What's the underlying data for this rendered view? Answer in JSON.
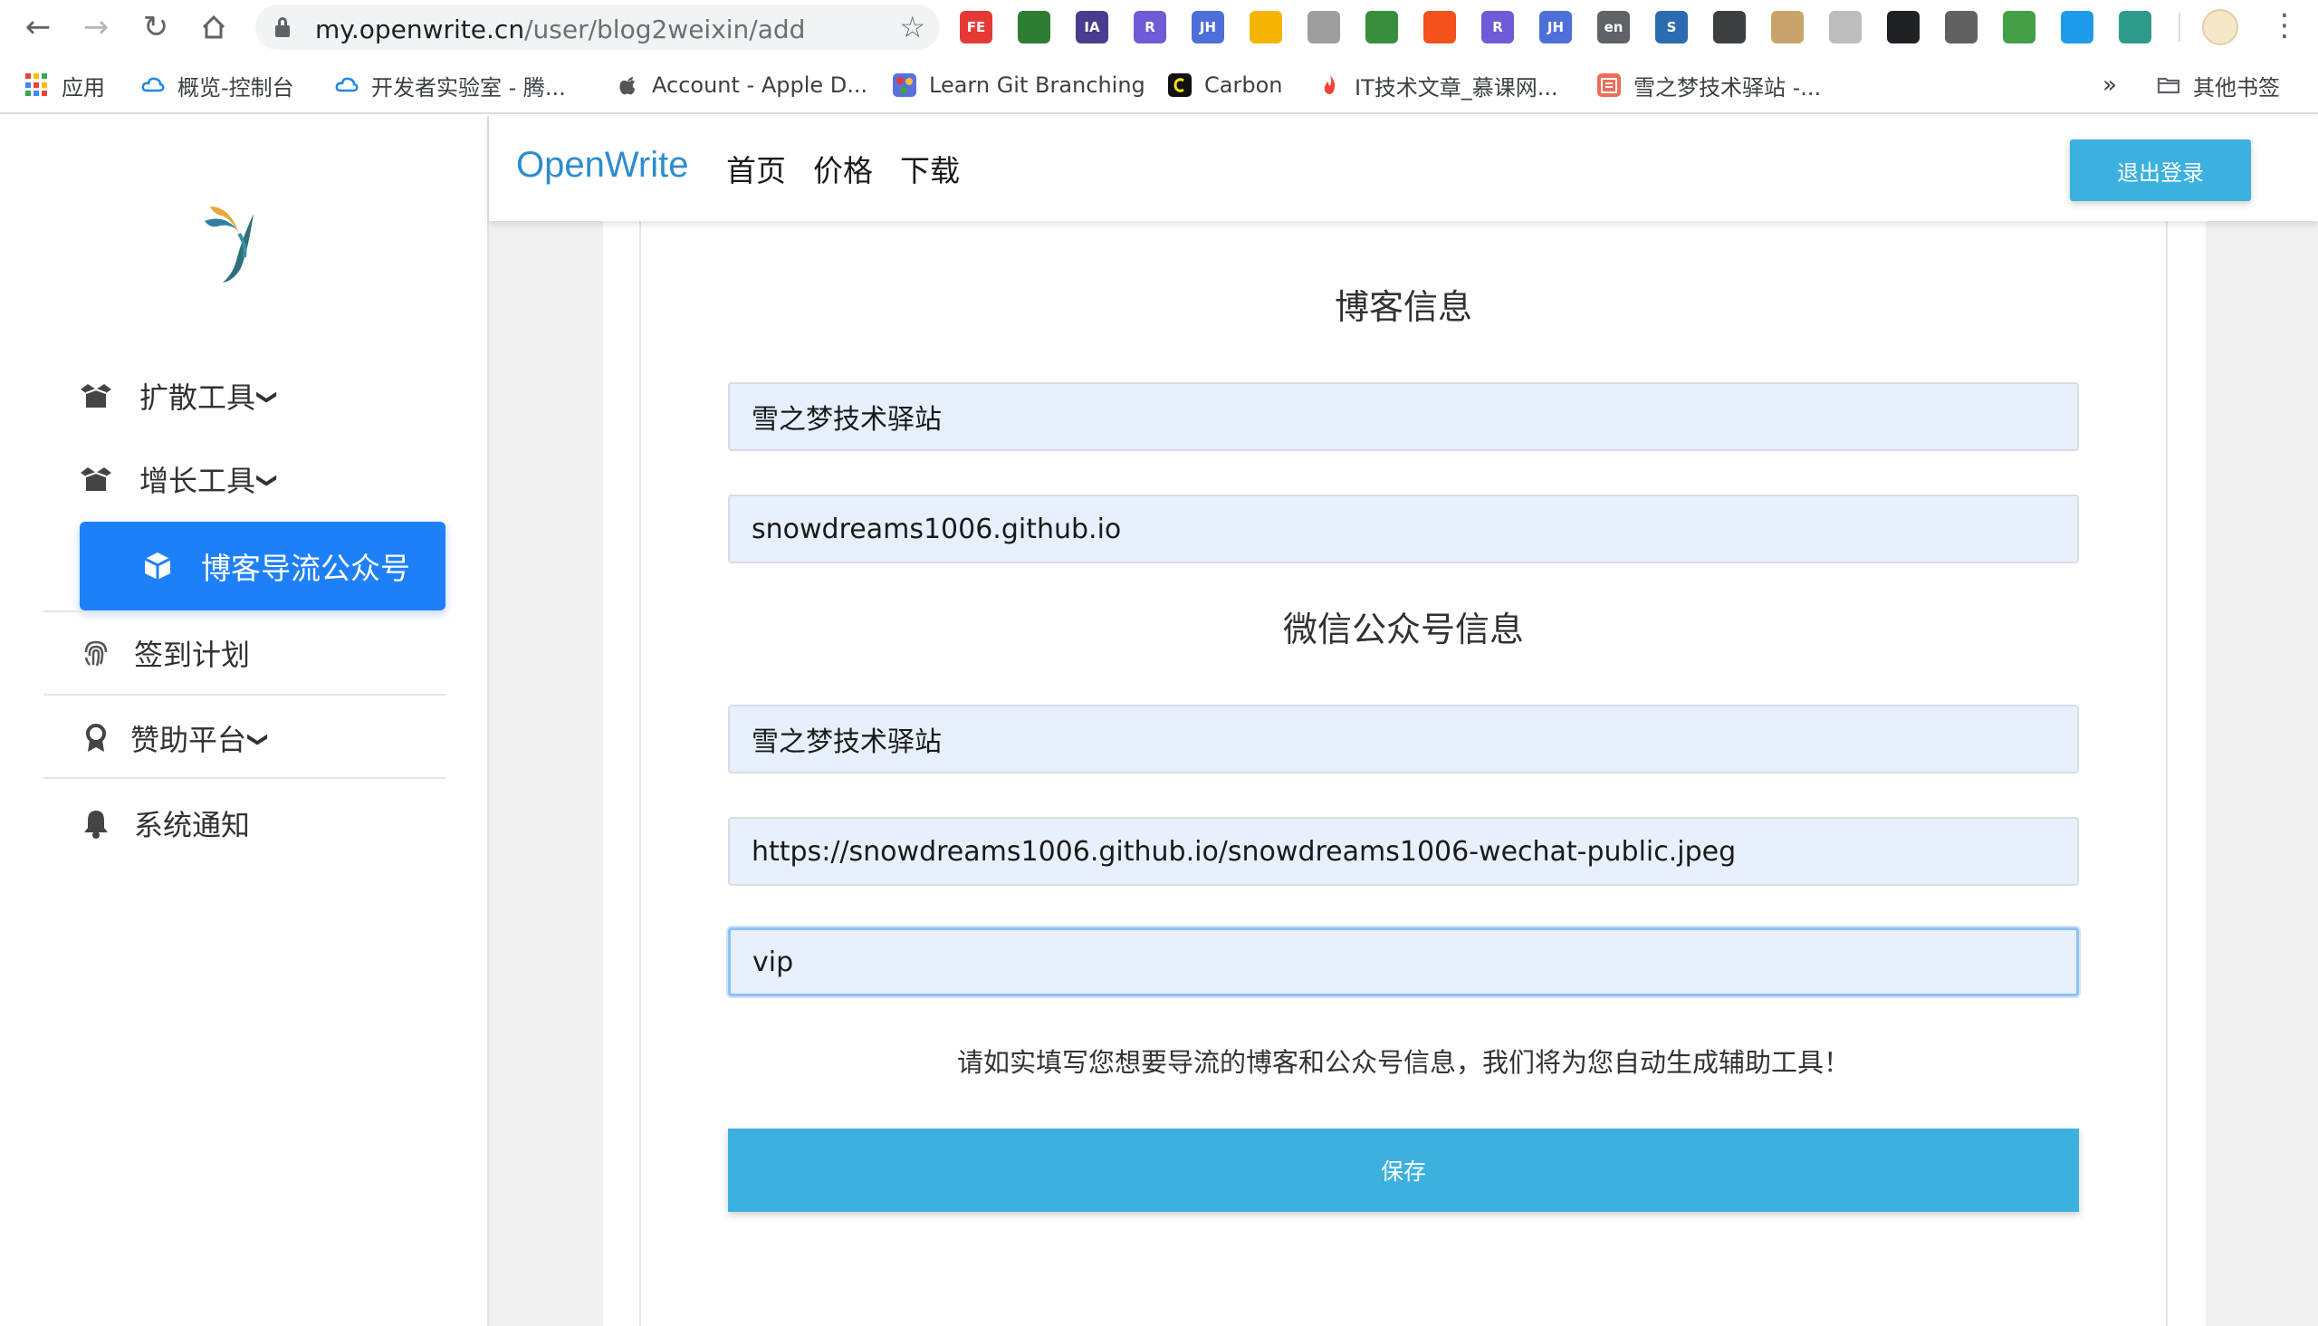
{
  "browser": {
    "url_host": "my.openwrite.cn",
    "url_path": "/user/blog2weixin/add",
    "extensions": [
      {
        "icon": "fe-icon",
        "text": "FE",
        "color": "#e53935"
      },
      {
        "icon": "globe-icon",
        "text": "",
        "color": "#2e7d32"
      },
      {
        "icon": "ia-icon",
        "text": "IA",
        "color": "#4a3b8f"
      },
      {
        "icon": "r-icon",
        "text": "R",
        "color": "#6f5bd6"
      },
      {
        "icon": "jh-icon",
        "text": "JH",
        "color": "#4f6fd8"
      },
      {
        "icon": "chrome-ring-icon",
        "text": "",
        "color": "#f4b400"
      },
      {
        "icon": "shield-icon",
        "text": "",
        "color": "#9e9e9e"
      },
      {
        "icon": "leaf-icon",
        "text": "",
        "color": "#388e3c"
      },
      {
        "icon": "translate-icon",
        "text": "",
        "color": "#f4511e"
      },
      {
        "icon": "r-icon",
        "text": "R",
        "color": "#6f5bd6"
      },
      {
        "icon": "jh-icon",
        "text": "JH",
        "color": "#4f6fd8"
      },
      {
        "icon": "en-icon",
        "text": "en",
        "color": "#5f6368"
      },
      {
        "icon": "s-icon",
        "text": "S",
        "color": "#2b6cb0"
      },
      {
        "icon": "screenshot-icon",
        "text": "",
        "color": "#3c4043"
      },
      {
        "icon": "dictionary-icon",
        "text": "",
        "color": "#c9a46a"
      },
      {
        "icon": "speed-icon",
        "text": "",
        "color": "#bdbdbd"
      },
      {
        "icon": "glasses-icon",
        "text": "",
        "color": "#202124"
      },
      {
        "icon": "window-icon",
        "text": "",
        "color": "#616161"
      },
      {
        "icon": "palette-icon",
        "text": "",
        "color": "#43a047"
      },
      {
        "icon": "eye-icon",
        "text": "",
        "color": "#1e9be9"
      },
      {
        "icon": "openwrite-icon",
        "text": "",
        "color": "#2e9b8a"
      }
    ],
    "bookmarks": [
      {
        "label": "应用",
        "icon": "apps-grid-icon"
      },
      {
        "label": "概览-控制台",
        "icon": "cloud-icon",
        "color": "#1e88e5"
      },
      {
        "label": "开发者实验室 - 腾...",
        "icon": "cloud-icon",
        "color": "#1e88e5"
      },
      {
        "label": "Account - Apple D...",
        "icon": "apple-icon",
        "color": "#555555"
      },
      {
        "label": "Learn Git Branching",
        "icon": "git-icon",
        "color": "#6c6ce0"
      },
      {
        "label": "Carbon",
        "icon": "carbon-icon",
        "color": "#111111"
      },
      {
        "label": "IT技术文章_慕课网...",
        "icon": "flame-icon",
        "color": "#f44336"
      },
      {
        "label": "雪之梦技术驿站 -...",
        "icon": "jian-icon",
        "color": "#ea6f5a"
      }
    ],
    "more_bookmarks": "»",
    "other_bookmarks": "其他书签"
  },
  "sidebar": {
    "items": [
      {
        "label": "扩散工具",
        "icon": "box-icon",
        "chevron": true
      },
      {
        "label": "增长工具",
        "icon": "box-icon",
        "chevron": true
      },
      {
        "label": "博客导流公众号",
        "icon": "cube-icon",
        "active": true
      },
      {
        "label": "签到计划",
        "icon": "fingerprint-icon"
      },
      {
        "label": "赞助平台",
        "icon": "award-icon",
        "chevron": true
      },
      {
        "label": "系统通知",
        "icon": "bell-icon"
      }
    ]
  },
  "header": {
    "brand": "OpenWrite",
    "nav": [
      "首页",
      "价格",
      "下载"
    ],
    "logout": "退出登录"
  },
  "form": {
    "blog_section_title": "博客信息",
    "blog_name": "雪之梦技术驿站",
    "blog_url": "snowdreams1006.github.io",
    "wechat_section_title": "微信公众号信息",
    "wechat_name": "雪之梦技术驿站",
    "wechat_qrcode_url": "https://snowdreams1006.github.io/snowdreams1006-wechat-public.jpeg",
    "keyword": "vip",
    "hint": "请如实填写您想要导流的博客和公众号信息，我们将为您自动生成辅助工具！",
    "save": "保存"
  },
  "colors": {
    "accent": "#3cb1e0",
    "active_menu": "#1e80f8",
    "brand": "#2d8cd0",
    "input_bg": "#e8f0fe"
  }
}
